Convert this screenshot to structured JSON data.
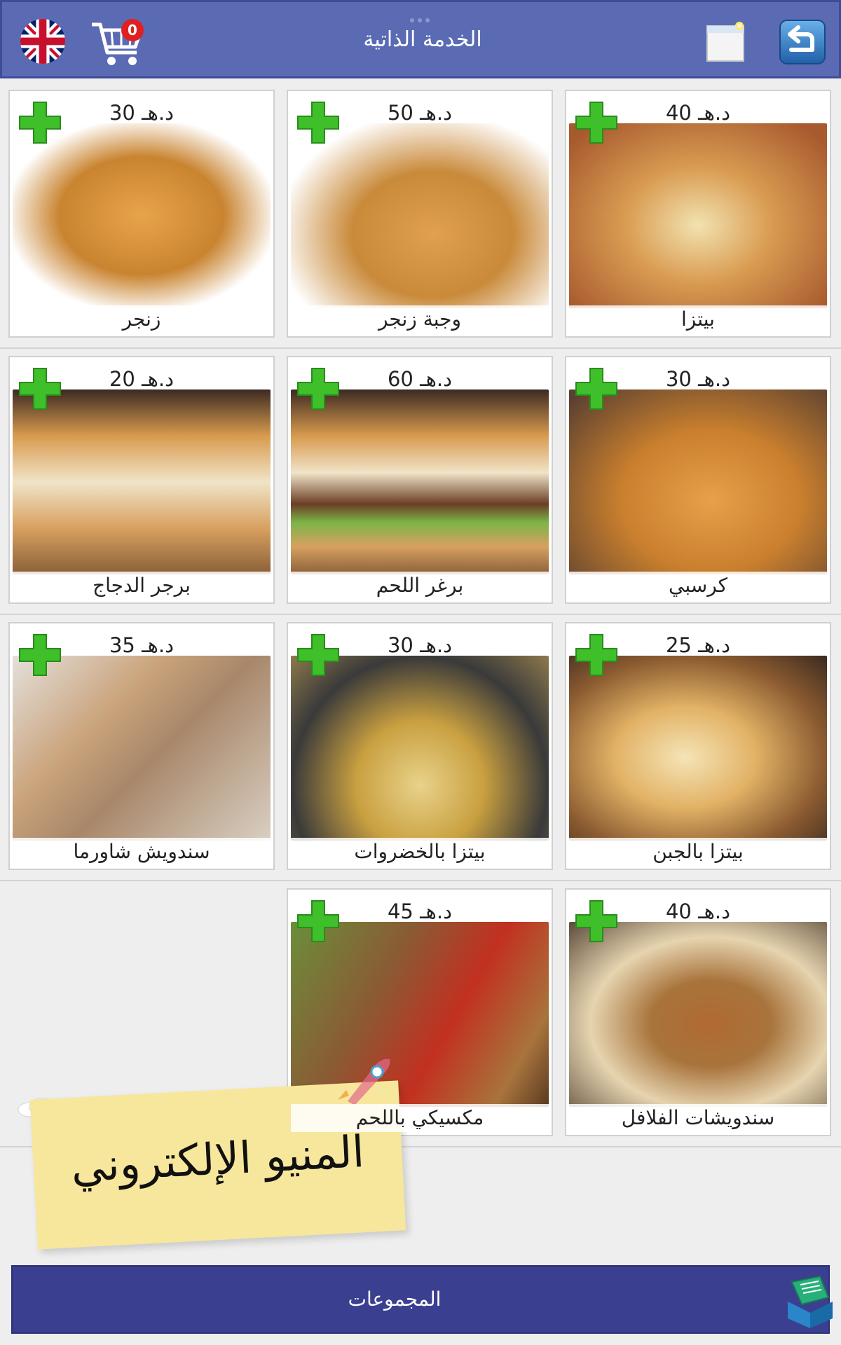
{
  "header": {
    "title": "الخدمة الذاتية",
    "cart_count": "0",
    "language_icon": "uk-flag-icon",
    "cart_icon": "shopping-cart-icon",
    "window_icon": "window-icon",
    "back_icon": "back-arrow-icon"
  },
  "menu": {
    "items": [
      {
        "name": "زنجر",
        "price": "30 د.هـ",
        "color": "#d9902c"
      },
      {
        "name": "وجبة زنجر",
        "price": "50 د.هـ",
        "color": "#c98a3a"
      },
      {
        "name": "بيتزا",
        "price": "40 د.هـ",
        "color": "#c97a38"
      },
      {
        "name": "برجر الدجاج",
        "price": "20 د.هـ",
        "color": "#b8793e"
      },
      {
        "name": "برغر اللحم",
        "price": "60 د.هـ",
        "color": "#9c6a3e"
      },
      {
        "name": "كرسبي",
        "price": "30 د.هـ",
        "color": "#c97f2e"
      },
      {
        "name": "سندويش شاورما",
        "price": "35 د.هـ",
        "color": "#a8876a"
      },
      {
        "name": "بيتزا بالخضروات",
        "price": "30 د.هـ",
        "color": "#8e7a4c"
      },
      {
        "name": "بيتزا بالجبن",
        "price": "25 د.هـ",
        "color": "#d9a55e"
      },
      {
        "name": "مكسيكي باللحم",
        "price": "45 د.هـ",
        "color": "#8b5a34"
      },
      {
        "name": "سندويشات الفلافل",
        "price": "40 د.هـ",
        "color": "#a8743c"
      }
    ],
    "add_icon": "green-plus-icon"
  },
  "note": {
    "text": "المنيو الإلكتروني"
  },
  "bottom": {
    "label": "المجموعات",
    "icon": "book-stack-icon"
  }
}
